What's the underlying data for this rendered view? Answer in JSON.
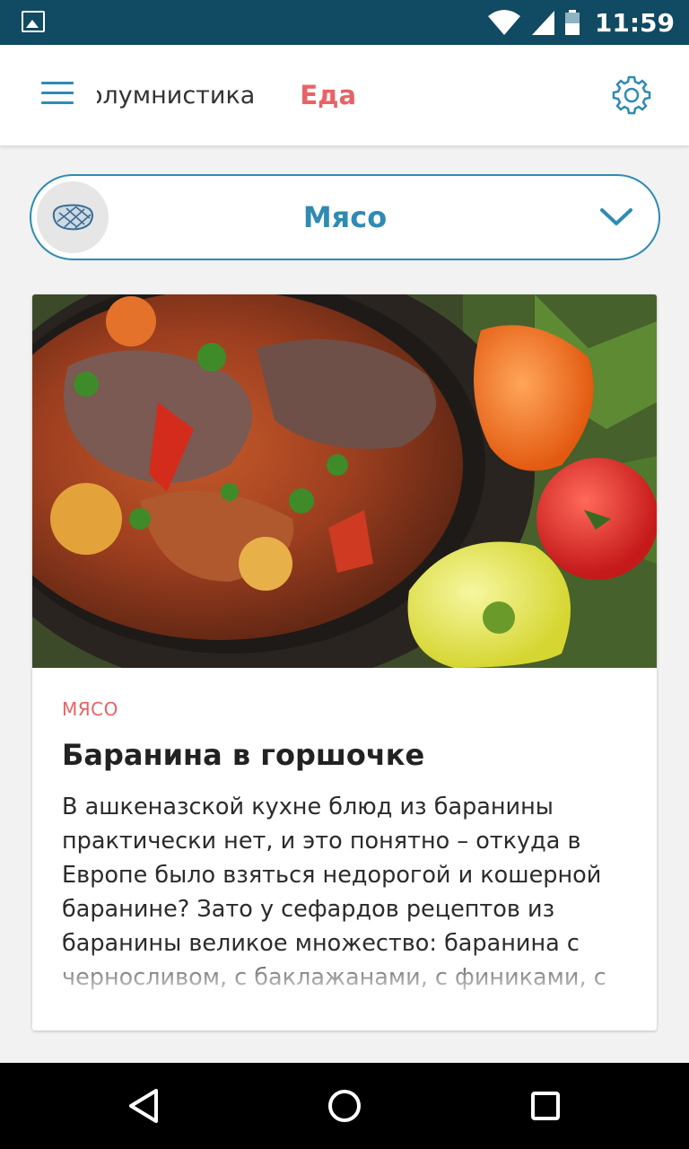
{
  "status_bar": {
    "time": "11:59",
    "icons": [
      "image-notification-icon",
      "wifi-icon",
      "cell-signal-icon",
      "battery-icon"
    ]
  },
  "app_bar": {
    "tabs": [
      {
        "label": "олумнистика",
        "active": false
      },
      {
        "label": "Еда",
        "active": true
      }
    ],
    "colors": {
      "accent": "#2f8bb3",
      "active_tab": "#e86266"
    }
  },
  "category_select": {
    "icon": "steak-icon",
    "selected": "Мясо"
  },
  "article_card": {
    "image": "lamb-stew-pot-photo",
    "category": "МЯСО",
    "title": "Баранина в горшочке",
    "excerpt": "В ашкеназской кухне блюд из баранины практически нет, и это понятно – откуда в Европе было взяться недорогой и кошерной баранине? Зато у сефардов рецептов из баранины великое множество: баранина с черносливом, с баклажанами, с финиками, с"
  },
  "nav_bar": {
    "buttons": [
      "back-icon",
      "home-icon",
      "recents-icon"
    ]
  }
}
